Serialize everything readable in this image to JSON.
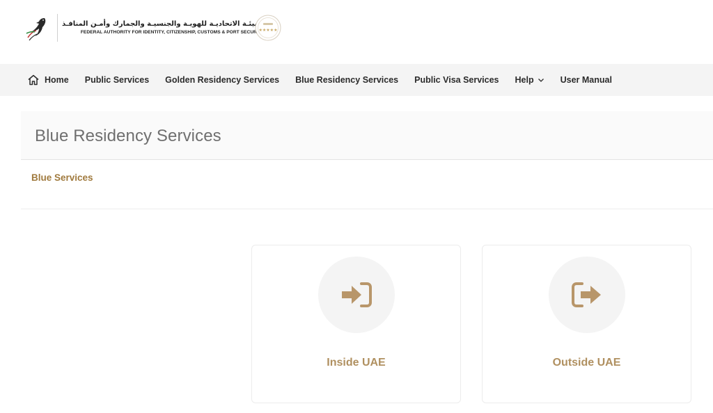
{
  "header": {
    "logo_text_ar": "الهيئـة الاتحاديـة للهويـة والجنسيـة والجمارك وأمـن المنافـذ",
    "logo_text_en": "FEDERAL AUTHORITY FOR IDENTITY, CITIZENSHIP, CUSTOMS & PORT SECURITY",
    "logo_icon": "falcon-logo-icon",
    "seal_icon": "five-star-seal-icon"
  },
  "nav": {
    "home": "Home",
    "public_services": "Public Services",
    "golden_residency": "Golden Residency Services",
    "blue_residency": "Blue Residency Services",
    "public_visa": "Public Visa Services",
    "help": "Help",
    "user_manual": "User Manual"
  },
  "page": {
    "title": "Blue Residency Services",
    "section_heading": "Blue Services"
  },
  "cards": [
    {
      "label": "Inside UAE",
      "icon": "sign-in-icon"
    },
    {
      "label": "Outside UAE",
      "icon": "sign-out-icon"
    }
  ],
  "colors": {
    "accent_gold": "#a07a3e",
    "icon_gold": "#b8966a",
    "nav_bg": "#f4f4f4"
  }
}
